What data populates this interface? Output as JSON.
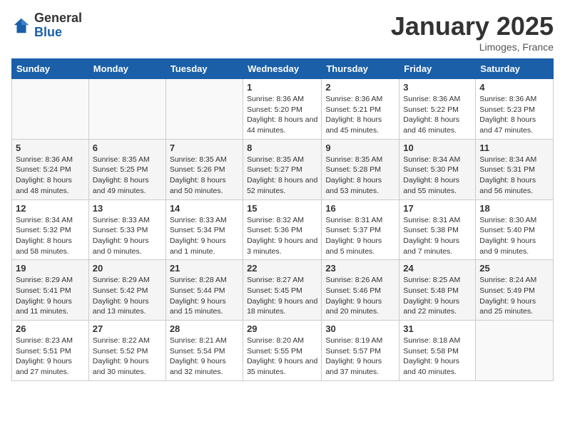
{
  "header": {
    "logo_general": "General",
    "logo_blue": "Blue",
    "month_title": "January 2025",
    "location": "Limoges, France"
  },
  "days_of_week": [
    "Sunday",
    "Monday",
    "Tuesday",
    "Wednesday",
    "Thursday",
    "Friday",
    "Saturday"
  ],
  "weeks": [
    [
      {
        "day": "",
        "sunrise": "",
        "sunset": "",
        "daylight": ""
      },
      {
        "day": "",
        "sunrise": "",
        "sunset": "",
        "daylight": ""
      },
      {
        "day": "",
        "sunrise": "",
        "sunset": "",
        "daylight": ""
      },
      {
        "day": "1",
        "sunrise": "Sunrise: 8:36 AM",
        "sunset": "Sunset: 5:20 PM",
        "daylight": "Daylight: 8 hours and 44 minutes."
      },
      {
        "day": "2",
        "sunrise": "Sunrise: 8:36 AM",
        "sunset": "Sunset: 5:21 PM",
        "daylight": "Daylight: 8 hours and 45 minutes."
      },
      {
        "day": "3",
        "sunrise": "Sunrise: 8:36 AM",
        "sunset": "Sunset: 5:22 PM",
        "daylight": "Daylight: 8 hours and 46 minutes."
      },
      {
        "day": "4",
        "sunrise": "Sunrise: 8:36 AM",
        "sunset": "Sunset: 5:23 PM",
        "daylight": "Daylight: 8 hours and 47 minutes."
      }
    ],
    [
      {
        "day": "5",
        "sunrise": "Sunrise: 8:36 AM",
        "sunset": "Sunset: 5:24 PM",
        "daylight": "Daylight: 8 hours and 48 minutes."
      },
      {
        "day": "6",
        "sunrise": "Sunrise: 8:35 AM",
        "sunset": "Sunset: 5:25 PM",
        "daylight": "Daylight: 8 hours and 49 minutes."
      },
      {
        "day": "7",
        "sunrise": "Sunrise: 8:35 AM",
        "sunset": "Sunset: 5:26 PM",
        "daylight": "Daylight: 8 hours and 50 minutes."
      },
      {
        "day": "8",
        "sunrise": "Sunrise: 8:35 AM",
        "sunset": "Sunset: 5:27 PM",
        "daylight": "Daylight: 8 hours and 52 minutes."
      },
      {
        "day": "9",
        "sunrise": "Sunrise: 8:35 AM",
        "sunset": "Sunset: 5:28 PM",
        "daylight": "Daylight: 8 hours and 53 minutes."
      },
      {
        "day": "10",
        "sunrise": "Sunrise: 8:34 AM",
        "sunset": "Sunset: 5:30 PM",
        "daylight": "Daylight: 8 hours and 55 minutes."
      },
      {
        "day": "11",
        "sunrise": "Sunrise: 8:34 AM",
        "sunset": "Sunset: 5:31 PM",
        "daylight": "Daylight: 8 hours and 56 minutes."
      }
    ],
    [
      {
        "day": "12",
        "sunrise": "Sunrise: 8:34 AM",
        "sunset": "Sunset: 5:32 PM",
        "daylight": "Daylight: 8 hours and 58 minutes."
      },
      {
        "day": "13",
        "sunrise": "Sunrise: 8:33 AM",
        "sunset": "Sunset: 5:33 PM",
        "daylight": "Daylight: 9 hours and 0 minutes."
      },
      {
        "day": "14",
        "sunrise": "Sunrise: 8:33 AM",
        "sunset": "Sunset: 5:34 PM",
        "daylight": "Daylight: 9 hours and 1 minute."
      },
      {
        "day": "15",
        "sunrise": "Sunrise: 8:32 AM",
        "sunset": "Sunset: 5:36 PM",
        "daylight": "Daylight: 9 hours and 3 minutes."
      },
      {
        "day": "16",
        "sunrise": "Sunrise: 8:31 AM",
        "sunset": "Sunset: 5:37 PM",
        "daylight": "Daylight: 9 hours and 5 minutes."
      },
      {
        "day": "17",
        "sunrise": "Sunrise: 8:31 AM",
        "sunset": "Sunset: 5:38 PM",
        "daylight": "Daylight: 9 hours and 7 minutes."
      },
      {
        "day": "18",
        "sunrise": "Sunrise: 8:30 AM",
        "sunset": "Sunset: 5:40 PM",
        "daylight": "Daylight: 9 hours and 9 minutes."
      }
    ],
    [
      {
        "day": "19",
        "sunrise": "Sunrise: 8:29 AM",
        "sunset": "Sunset: 5:41 PM",
        "daylight": "Daylight: 9 hours and 11 minutes."
      },
      {
        "day": "20",
        "sunrise": "Sunrise: 8:29 AM",
        "sunset": "Sunset: 5:42 PM",
        "daylight": "Daylight: 9 hours and 13 minutes."
      },
      {
        "day": "21",
        "sunrise": "Sunrise: 8:28 AM",
        "sunset": "Sunset: 5:44 PM",
        "daylight": "Daylight: 9 hours and 15 minutes."
      },
      {
        "day": "22",
        "sunrise": "Sunrise: 8:27 AM",
        "sunset": "Sunset: 5:45 PM",
        "daylight": "Daylight: 9 hours and 18 minutes."
      },
      {
        "day": "23",
        "sunrise": "Sunrise: 8:26 AM",
        "sunset": "Sunset: 5:46 PM",
        "daylight": "Daylight: 9 hours and 20 minutes."
      },
      {
        "day": "24",
        "sunrise": "Sunrise: 8:25 AM",
        "sunset": "Sunset: 5:48 PM",
        "daylight": "Daylight: 9 hours and 22 minutes."
      },
      {
        "day": "25",
        "sunrise": "Sunrise: 8:24 AM",
        "sunset": "Sunset: 5:49 PM",
        "daylight": "Daylight: 9 hours and 25 minutes."
      }
    ],
    [
      {
        "day": "26",
        "sunrise": "Sunrise: 8:23 AM",
        "sunset": "Sunset: 5:51 PM",
        "daylight": "Daylight: 9 hours and 27 minutes."
      },
      {
        "day": "27",
        "sunrise": "Sunrise: 8:22 AM",
        "sunset": "Sunset: 5:52 PM",
        "daylight": "Daylight: 9 hours and 30 minutes."
      },
      {
        "day": "28",
        "sunrise": "Sunrise: 8:21 AM",
        "sunset": "Sunset: 5:54 PM",
        "daylight": "Daylight: 9 hours and 32 minutes."
      },
      {
        "day": "29",
        "sunrise": "Sunrise: 8:20 AM",
        "sunset": "Sunset: 5:55 PM",
        "daylight": "Daylight: 9 hours and 35 minutes."
      },
      {
        "day": "30",
        "sunrise": "Sunrise: 8:19 AM",
        "sunset": "Sunset: 5:57 PM",
        "daylight": "Daylight: 9 hours and 37 minutes."
      },
      {
        "day": "31",
        "sunrise": "Sunrise: 8:18 AM",
        "sunset": "Sunset: 5:58 PM",
        "daylight": "Daylight: 9 hours and 40 minutes."
      },
      {
        "day": "",
        "sunrise": "",
        "sunset": "",
        "daylight": ""
      }
    ]
  ]
}
